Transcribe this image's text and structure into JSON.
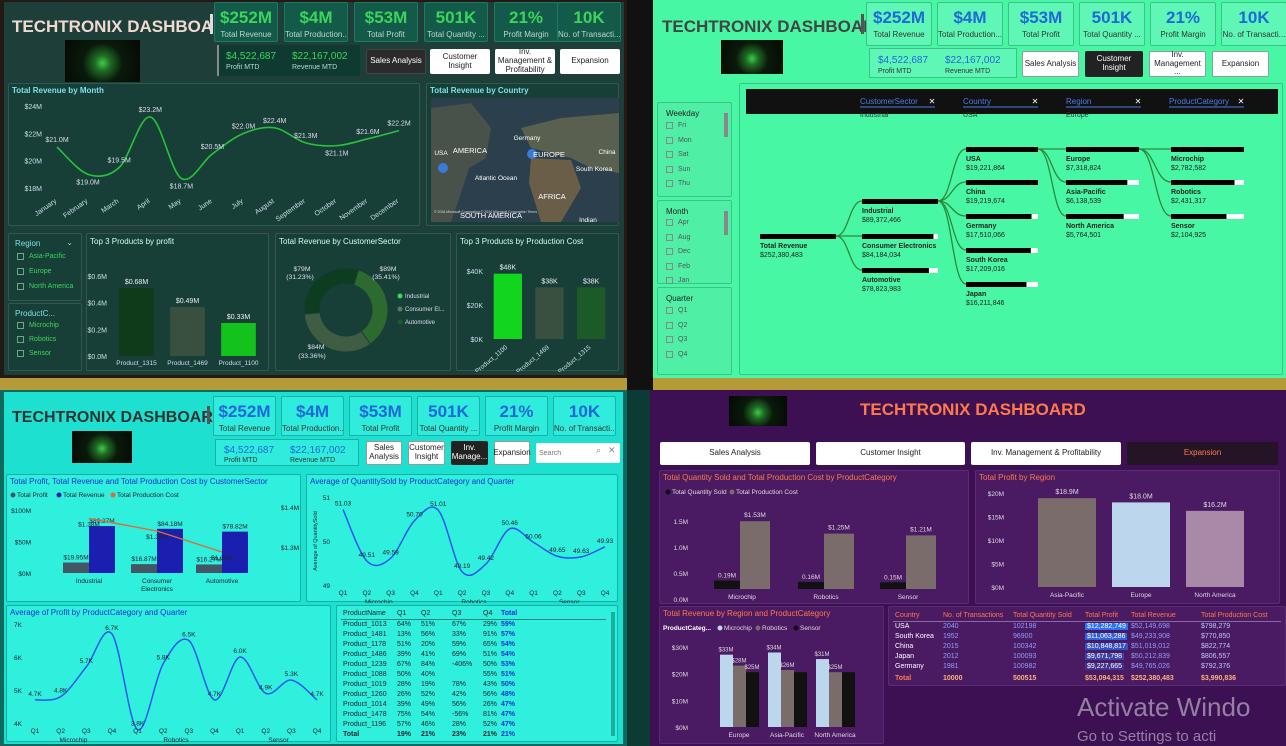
{
  "title": "TECHTRONIX DASHBOARD",
  "kpis": [
    {
      "value": "$252M",
      "label": "Total Revenue"
    },
    {
      "value": "$4M",
      "label": "Total Production..."
    },
    {
      "value": "$53M",
      "label": "Total Profit"
    },
    {
      "value": "501K",
      "label": "Total Quantity ..."
    },
    {
      "value": "21%",
      "label": "Profit Margin"
    },
    {
      "value": "10K",
      "label": "No. of Transacti..."
    }
  ],
  "mtd": {
    "profit_value": "$4,522,687",
    "profit_label": "Profit MTD",
    "revenue_value": "$22,167,002",
    "revenue_label": "Revenue MTD"
  },
  "nav": {
    "sales": "Sales Analysis",
    "customer": "Customer Insight",
    "inventory": "Inv. Management & Profitability",
    "inventory_short": "Inv. Manage...",
    "inventory_mid": "Inv. Management ...",
    "expansion": "Expansion",
    "search": "Search"
  },
  "q1": {
    "revenue_month": {
      "title": "Total Revenue by Month",
      "yticks": [
        "$24M",
        "$22M",
        "$20M",
        "$18M"
      ],
      "chart_data": {
        "type": "line",
        "categories": [
          "January",
          "February",
          "March",
          "April",
          "May",
          "June",
          "July",
          "August",
          "September",
          "October",
          "November",
          "December"
        ],
        "values": [
          21.0,
          19.0,
          19.5,
          23.2,
          18.7,
          20.5,
          22.0,
          22.4,
          21.3,
          21.1,
          21.6,
          22.2
        ],
        "labels": [
          "$21.0M",
          "$19.0M",
          "$19.5M",
          "$23.2M",
          "$18.7M",
          "$20.5M",
          "$22.0M",
          "$22.4M",
          "$21.3M",
          "$21.1M",
          "$21.6M",
          "$22.2M"
        ],
        "ylim": [
          18,
          24
        ]
      }
    },
    "map": {
      "title": "Total Revenue by Country",
      "labels": [
        "Germany",
        "EUROPE",
        "AMERICA",
        "Atlantic Ocean",
        "AFRICA",
        "South Korea",
        "China",
        "SOUTH AMERICA",
        "Indian",
        "USA"
      ],
      "credit": "© 2024 Microsoft Corporation © 2024 Microsoft Corporation Terms"
    },
    "region_slicer": {
      "title": "Region",
      "items": [
        "Asia-Pacific",
        "Europe",
        "North America"
      ]
    },
    "product_slicer": {
      "title": "ProductC...",
      "items": [
        "Microchip",
        "Robotics",
        "Sensor"
      ]
    },
    "top_profit": {
      "title": "Top 3 Products by profit",
      "yticks": [
        "$0.6M",
        "$0.4M",
        "$0.2M",
        "$0.0M"
      ],
      "chart_data": {
        "type": "bar",
        "categories": [
          "Product_1315",
          "Product_1469",
          "Product_1100"
        ],
        "values": [
          0.68,
          0.49,
          0.33
        ],
        "labels": [
          "$0.68M",
          "$0.49M",
          "$0.33M"
        ],
        "ylim": [
          0,
          0.8
        ]
      }
    },
    "donut": {
      "title": "Total Revenue by CustomerSector",
      "labels": [
        "$79M",
        "(31.23%)",
        "$89M",
        "(35.41%)",
        "$84M",
        "(33.36%)"
      ],
      "chart_data": {
        "type": "pie",
        "categories": [
          "Industrial",
          "Consumer El...",
          "Automotive"
        ],
        "values": [
          89,
          84,
          79
        ]
      }
    },
    "top_cost": {
      "title": "Top 3 Products by Production Cost",
      "yticks": [
        "$40K",
        "$20K",
        "$0K"
      ],
      "chart_data": {
        "type": "bar",
        "categories": [
          "Product_1100",
          "Product_1469",
          "Product_1315"
        ],
        "values": [
          48,
          38,
          38
        ],
        "labels": [
          "$48K",
          "$38K",
          "$38K"
        ],
        "ylim": [
          0,
          50
        ]
      }
    }
  },
  "q2": {
    "weekday": {
      "title": "Weekday",
      "items": [
        "Fri",
        "Mon",
        "Sat",
        "Sun",
        "Thu"
      ]
    },
    "month": {
      "title": "Month",
      "items": [
        "Apr",
        "Aug",
        "Dec",
        "Feb",
        "Jan"
      ]
    },
    "quarter": {
      "title": "Quarter",
      "items": [
        "Q1",
        "Q2",
        "Q3",
        "Q4"
      ]
    },
    "filters": [
      {
        "label": "CustomerSector",
        "value": "Industrial"
      },
      {
        "label": "Country",
        "value": "USA"
      },
      {
        "label": "Region",
        "value": "Europe"
      },
      {
        "label": "ProductCategory",
        "value": ""
      }
    ],
    "tree": {
      "root": {
        "name": "Total Revenue",
        "value": "$252,380,483"
      },
      "sector": [
        {
          "name": "Industrial",
          "value": "$89,372,466"
        },
        {
          "name": "Consumer Electronics",
          "value": "$84,184,034"
        },
        {
          "name": "Automotive",
          "value": "$78,823,983"
        }
      ],
      "country": [
        {
          "name": "USA",
          "value": "$19,221,864"
        },
        {
          "name": "China",
          "value": "$19,219,674"
        },
        {
          "name": "Germany",
          "value": "$17,510,066"
        },
        {
          "name": "South Korea",
          "value": "$17,209,016"
        },
        {
          "name": "Japan",
          "value": "$16,211,846"
        }
      ],
      "region": [
        {
          "name": "Europe",
          "value": "$7,318,824"
        },
        {
          "name": "Asia-Pacific",
          "value": "$6,138,539"
        },
        {
          "name": "North America",
          "value": "$5,764,501"
        }
      ],
      "category": [
        {
          "name": "Microchip",
          "value": "$2,782,582"
        },
        {
          "name": "Robotics",
          "value": "$2,431,317"
        },
        {
          "name": "Sensor",
          "value": "$2,104,925"
        }
      ]
    }
  },
  "q3": {
    "combo": {
      "title": "Total Profit, Total Revenue and Total Production Cost by CustomerSector",
      "legend": [
        "Total Profit",
        "Total Revenue",
        "Total Production Cost"
      ],
      "yticks": [
        "$100M",
        "$50M",
        "$0M"
      ],
      "y2ticks": [
        "$1.4M",
        "$1.3M"
      ],
      "chart_data": {
        "type": "bar",
        "categories": [
          "Industrial",
          "Consumer Electronics",
          "Automotive"
        ],
        "series": [
          {
            "name": "Total Profit",
            "values": [
              19.95,
              16.87,
              16.27
            ],
            "labels": [
              "$19.95M",
              "$16.87M",
              "$16.27M"
            ]
          },
          {
            "name": "Total Revenue",
            "values": [
              89.37,
              84.18,
              78.82
            ],
            "labels": [
              "$89.37M",
              "$84.18M",
              "$78.82M"
            ]
          },
          {
            "name": "Total Production Cost",
            "values": [
              1.38,
              1.35,
              1.3
            ],
            "labels": [
              "$1.38M",
              "$1.35M",
              "$1.30M"
            ]
          }
        ]
      }
    },
    "avg_qty": {
      "title": "Average of QuantitySold by ProductCategory and Quarter",
      "ylabel": "Average of QuantitySold",
      "yticks": [
        "51",
        "50",
        "49"
      ],
      "chart_data": {
        "type": "line",
        "groups": [
          "Microchip",
          "Robotics",
          "Sensor"
        ],
        "quarters": [
          "Q1",
          "Q2",
          "Q3",
          "Q4",
          "Q1",
          "Q2",
          "Q3",
          "Q4",
          "Q1",
          "Q2",
          "Q3",
          "Q4"
        ],
        "values": [
          51.03,
          49.51,
          49.59,
          50.7,
          51.01,
          49.19,
          49.42,
          50.46,
          50.06,
          49.65,
          49.63,
          49.93
        ],
        "labels": [
          "51.03",
          "49.51",
          "49.59",
          "50.70",
          "51.01",
          "49.19",
          "49.42",
          "50.46",
          "50.06",
          "49.65",
          "49.63",
          "49.93"
        ],
        "ylim": [
          48.8,
          51.4
        ]
      }
    },
    "avg_profit": {
      "title": "Average of Profit by ProductCategory and Quarter",
      "yticks": [
        "7K",
        "6K",
        "5K",
        "4K"
      ],
      "chart_data": {
        "type": "line",
        "groups": [
          "Microchip",
          "Robotics",
          "Sensor"
        ],
        "quarters": [
          "Q1",
          "Q2",
          "Q3",
          "Q4",
          "Q1",
          "Q2",
          "Q3",
          "Q4",
          "Q1",
          "Q2",
          "Q3",
          "Q4"
        ],
        "values": [
          4.7,
          4.8,
          5.7,
          6.7,
          3.8,
          5.8,
          6.5,
          4.7,
          6.0,
          4.9,
          5.3,
          4.7
        ],
        "labels": [
          "4.7K",
          "4.8K",
          "5.7K",
          "6.7K",
          "3.8K",
          "5.8K",
          "6.5K",
          "4.7K",
          "6.0K",
          "4.9K",
          "5.3K",
          "4.7K"
        ],
        "ylim": [
          4,
          7
        ]
      }
    },
    "table": {
      "headers": [
        "ProductName",
        "Q1",
        "Q2",
        "Q3",
        "Q4",
        "Total"
      ],
      "rows": [
        [
          "Product_1013",
          "64%",
          "51%",
          "67%",
          "29%",
          "59%"
        ],
        [
          "Product_1481",
          "13%",
          "56%",
          "33%",
          "91%",
          "57%"
        ],
        [
          "Product_1178",
          "51%",
          "20%",
          "59%",
          "65%",
          "54%"
        ],
        [
          "Product_1486",
          "39%",
          "41%",
          "69%",
          "51%",
          "54%"
        ],
        [
          "Product_1239",
          "67%",
          "84%",
          "-406%",
          "50%",
          "53%"
        ],
        [
          "Product_1088",
          "50%",
          "40%",
          "",
          "55%",
          "51%"
        ],
        [
          "Product_1019",
          "28%",
          "19%",
          "78%",
          "43%",
          "50%"
        ],
        [
          "Product_1260",
          "26%",
          "52%",
          "42%",
          "56%",
          "48%"
        ],
        [
          "Product_1014",
          "39%",
          "49%",
          "56%",
          "26%",
          "47%"
        ],
        [
          "Product_1478",
          "75%",
          "54%",
          "-56%",
          "81%",
          "47%"
        ],
        [
          "Product_1196",
          "57%",
          "46%",
          "28%",
          "52%",
          "47%"
        ]
      ],
      "total": [
        "Total",
        "19%",
        "21%",
        "23%",
        "21%",
        "21%"
      ]
    }
  },
  "q4": {
    "qty_cost": {
      "title": "Total Quantity Sold and Total Production Cost by ProductCategory",
      "legend": [
        "Total Quantity Sold",
        "Total Production Cost"
      ],
      "yticks": [
        "1.5M",
        "1.0M",
        "0.5M",
        "0.0M"
      ],
      "chart_data": {
        "type": "bar",
        "categories": [
          "Microchip",
          "Robotics",
          "Sensor"
        ],
        "series": [
          {
            "name": "Total Quantity Sold",
            "values": [
              0.19,
              0.16,
              0.15
            ],
            "labels": [
              "0.19M",
              "0.16M",
              "0.15M"
            ]
          },
          {
            "name": "Total Production Cost",
            "values": [
              1.53,
              1.25,
              1.21
            ],
            "labels": [
              "$1.53M",
              "$1.25M",
              "$1.21M"
            ]
          }
        ],
        "ylim": [
          0,
          2
        ]
      }
    },
    "profit_region": {
      "title": "Total Profit by Region",
      "yticks": [
        "$20M",
        "$15M",
        "$10M",
        "$5M",
        "$0M"
      ],
      "chart_data": {
        "type": "bar",
        "categories": [
          "Asia-Pacific",
          "Europe",
          "North America"
        ],
        "values": [
          18.9,
          18.0,
          16.2
        ],
        "labels": [
          "$18.9M",
          "$18.0M",
          "$16.2M"
        ],
        "ylim": [
          0,
          20
        ]
      }
    },
    "rev_region": {
      "title": "Total Revenue by Region and ProductCategory",
      "legend_title": "ProductCateg...",
      "legend": [
        "Microchip",
        "Robotics",
        "Sensor"
      ],
      "yticks": [
        "$30M",
        "$20M",
        "$10M",
        "$0M"
      ],
      "chart_data": {
        "type": "bar",
        "categories": [
          "Europe",
          "Asia-Pacific",
          "North America"
        ],
        "series": [
          {
            "name": "Microchip",
            "values": [
              33,
              34,
              31
            ],
            "labels": [
              "$33M",
              "$34M",
              "$31M"
            ]
          },
          {
            "name": "Robotics",
            "values": [
              28,
              26,
              25
            ],
            "labels": [
              "$28M",
              "$26M",
              "$25M"
            ]
          },
          {
            "name": "Sensor",
            "values": [
              25,
              25,
              25
            ],
            "labels": [
              "$25M",
              "",
              ""
            ]
          }
        ],
        "ylim": [
          0,
          37
        ]
      }
    },
    "table": {
      "headers": [
        "Country",
        "No. of Transactions",
        "Total Quantity Sold",
        "Total Profit",
        "Total Revenue",
        "Total Production Cost"
      ],
      "rows": [
        [
          "USA",
          "2040",
          "102198",
          "$12,282,749",
          "$52,149,698",
          "$798,279"
        ],
        [
          "South Korea",
          "1952",
          "96900",
          "$11,063,286",
          "$49,233,908",
          "$770,850"
        ],
        [
          "China",
          "2015",
          "100342",
          "$10,848,817",
          "$51,019,012",
          "$822,774"
        ],
        [
          "Japan",
          "2012",
          "100093",
          "$9,671,798",
          "$50,212,839",
          "$806,557"
        ],
        [
          "Germany",
          "1981",
          "100982",
          "$9,227,665",
          "$49,765,026",
          "$792,376"
        ]
      ],
      "total": [
        "Total",
        "10000",
        "500515",
        "$53,094,315",
        "$252,380,483",
        "$3,990,836"
      ]
    },
    "watermark": "Activate Windo",
    "watermark2": "Go to Settings to acti"
  }
}
